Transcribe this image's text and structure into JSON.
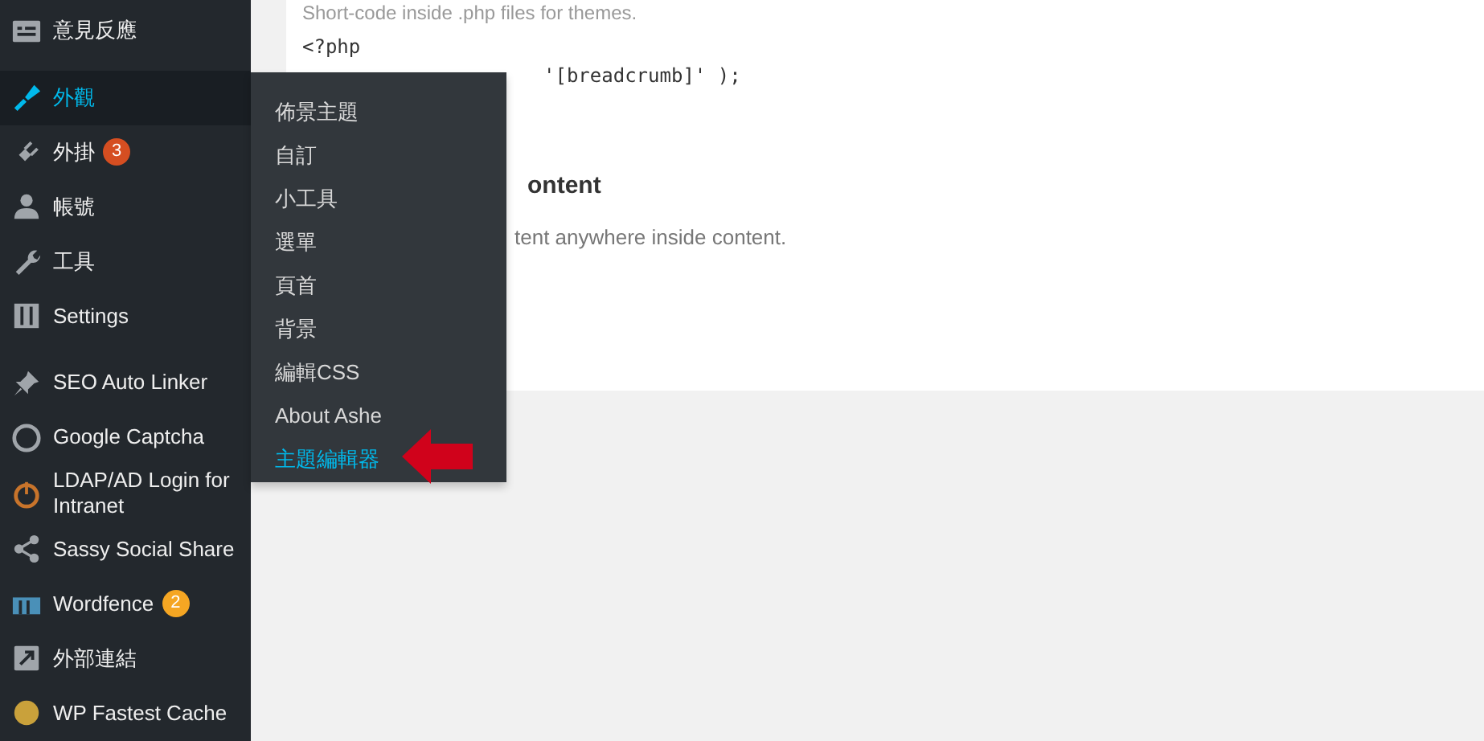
{
  "sidebar": {
    "items": [
      {
        "label": "意見反應",
        "selected": false
      },
      {
        "label": "外觀",
        "selected": true
      },
      {
        "label": "外掛",
        "selected": false,
        "badge": {
          "text": "3",
          "color": "#d54e21"
        }
      },
      {
        "label": "帳號",
        "selected": false
      },
      {
        "label": "工具",
        "selected": false
      },
      {
        "label": "Settings",
        "selected": false
      },
      {
        "label": "SEO Auto Linker",
        "selected": false
      },
      {
        "label": "Google Captcha",
        "selected": false
      },
      {
        "label": "LDAP/AD Login for Intranet",
        "selected": false
      },
      {
        "label": "Sassy Social Share",
        "selected": false
      },
      {
        "label": "Wordfence",
        "selected": false,
        "badge": {
          "text": "2",
          "color": "#f5a623"
        }
      },
      {
        "label": "外部連結",
        "selected": false
      },
      {
        "label": "WP Fastest Cache",
        "selected": false
      }
    ]
  },
  "submenu": {
    "items": [
      {
        "label": "佈景主題",
        "selected": false
      },
      {
        "label": "自訂",
        "selected": false
      },
      {
        "label": "小工具",
        "selected": false
      },
      {
        "label": "選單",
        "selected": false
      },
      {
        "label": "頁首",
        "selected": false
      },
      {
        "label": "背景",
        "selected": false
      },
      {
        "label": "編輯CSS",
        "selected": false
      },
      {
        "label": "About Ashe",
        "selected": false
      },
      {
        "label": "主題編輯器",
        "selected": true
      }
    ]
  },
  "content": {
    "intro": "Short-code inside .php files for themes.",
    "code_open": "<?php",
    "code_line": "'[breadcrumb]' );",
    "heading": "ontent",
    "description": "tent anywhere inside content."
  }
}
